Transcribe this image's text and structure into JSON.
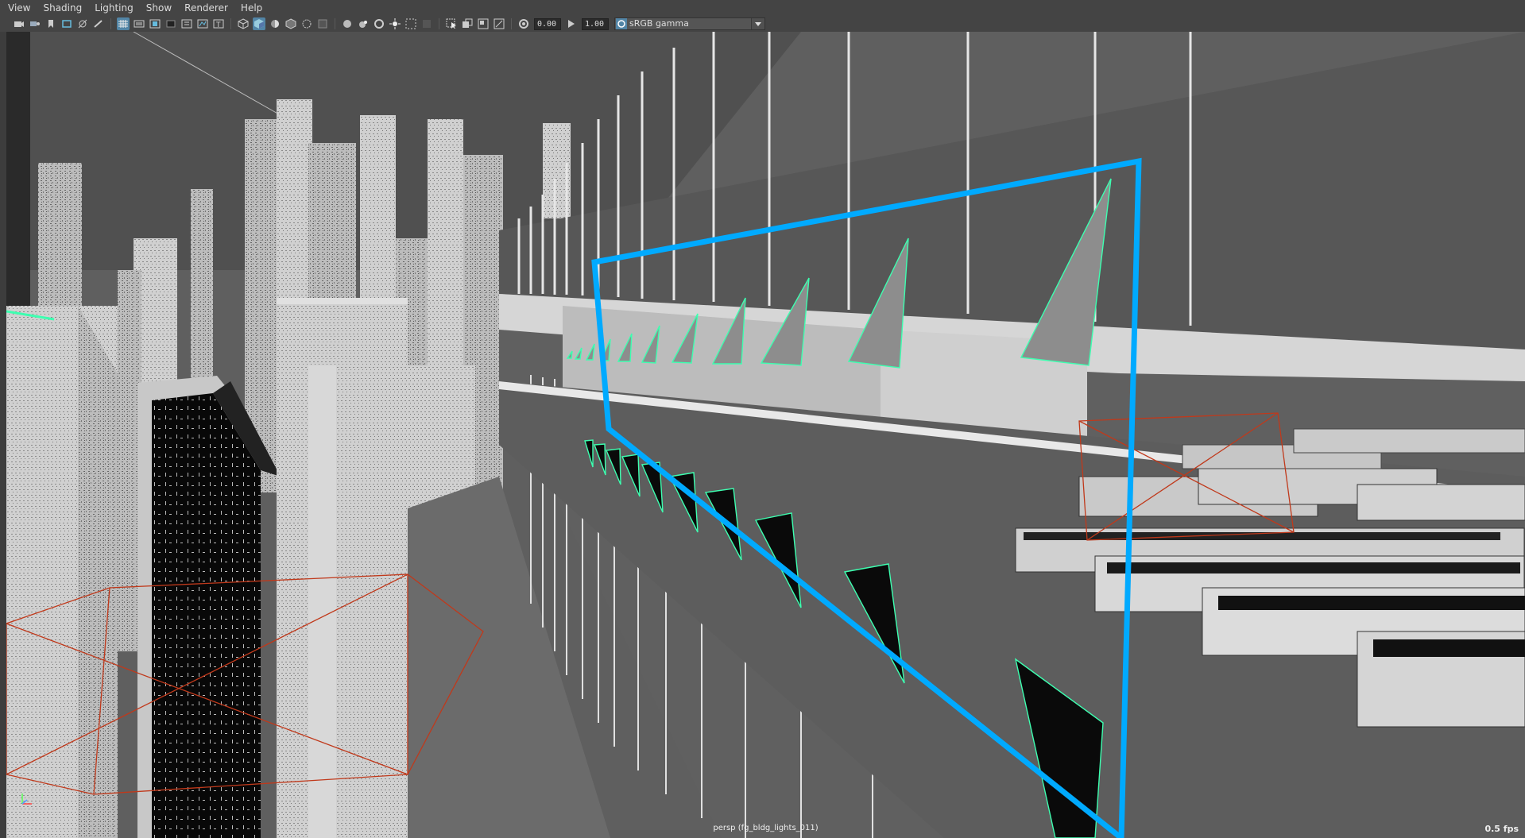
{
  "menu": {
    "items": [
      "View",
      "Shading",
      "Lighting",
      "Show",
      "Renderer",
      "Help"
    ]
  },
  "toolbar": {
    "exposure_value": "0.00",
    "gamma_value": "1.00",
    "color_space": "sRGB gamma",
    "icons": [
      "camera-icon",
      "camera-attributes-icon",
      "bookmark-icon",
      "image-plane-icon",
      "grid-icon",
      "film-gate-icon",
      "resolution-gate-icon",
      "gate-mask-icon",
      "field-chart-icon",
      "safe-action-icon",
      "safe-title-icon",
      "wireframe-icon",
      "smooth-shade-icon",
      "default-material-icon",
      "textured-icon",
      "use-all-lights-icon",
      "shadows-icon",
      "screen-space-ao-icon",
      "motion-blur-icon",
      "multisample-aa-icon",
      "depth-of-field-icon",
      "isolate-select-icon",
      "xray-icon",
      "xray-joints-icon",
      "backface-culling-icon",
      "exposure-icon",
      "gamma-icon",
      "color-management-icon"
    ]
  },
  "viewport": {
    "camera_label": "persp (fg_bldg_lights_011)",
    "fps": "0.5 fps",
    "selection_color": "#00aaff",
    "light_wire_color": "#3dffb0",
    "helper_color": "#c0391b"
  }
}
